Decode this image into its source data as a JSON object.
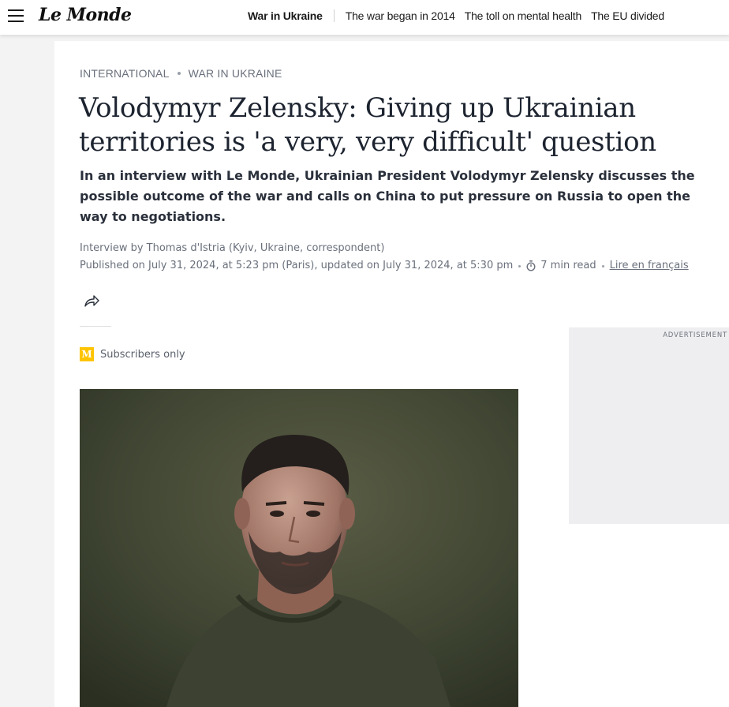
{
  "header": {
    "menu_icon": "hamburger-menu-icon",
    "logo": "Le Monde",
    "nav": [
      {
        "label": "War in Ukraine"
      },
      {
        "label": "The war began in 2014"
      },
      {
        "label": "The toll on mental health"
      },
      {
        "label": "The EU divided"
      }
    ]
  },
  "article": {
    "breadcrumb": [
      "INTERNATIONAL",
      "WAR IN UKRAINE"
    ],
    "title": "Volodymyr Zelensky: Giving up Ukrainian territories is 'a very, very difficult' question",
    "standfirst": "In an interview with Le Monde, Ukrainian President Volodymyr Zelensky discusses the possible outcome of the war and calls on China to put pressure on Russia to open the way to negotiations.",
    "byline": "Interview by Thomas d'Istria (Kyiv, Ukraine, correspondent)",
    "published": "Published on July 31, 2024, at 5:23 pm (Paris), updated on July 31, 2024, at 5:30 pm",
    "read_time": "7 min read",
    "french_link": "Lire en français",
    "share_icon": "share-arrow-icon",
    "subscribers_badge": "M",
    "subscribers_label": "Subscribers only"
  },
  "sidebar": {
    "ad_label": "ADVERTISEMENT"
  },
  "colors": {
    "background": "#f3f3f4",
    "text": "#2a303b",
    "muted": "#6a707c",
    "subscriber_badge": "#ffc400"
  }
}
